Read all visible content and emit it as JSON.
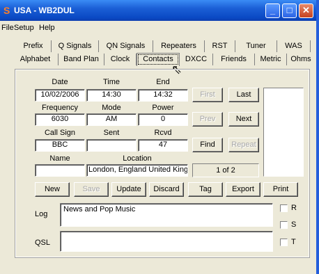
{
  "window": {
    "title": "USA - WB2DUL",
    "icon": "app-s-icon",
    "controls": {
      "minimize": "_",
      "maximize": "□",
      "close": "✕"
    }
  },
  "menu": [
    "File",
    "Setup",
    "Help"
  ],
  "tabs_row1": [
    "Prefix",
    "Q Signals",
    "QN Signals",
    "Repeaters",
    "RST",
    "Tuner",
    "WAS"
  ],
  "tabs_row2": [
    "Alphabet",
    "Band Plan",
    "Clock",
    "Contacts",
    "DXCC",
    "Friends",
    "Metric",
    "Ohms"
  ],
  "active_tab": "Contacts",
  "contact": {
    "date_label": "Date",
    "date": "10/02/2006",
    "time_label": "Time",
    "time": "14:30",
    "end_label": "End",
    "end": "14:32",
    "frequency_label": "Frequency",
    "frequency": "6030",
    "mode_label": "Mode",
    "mode": "AM",
    "power_label": "Power",
    "power": "0",
    "callsign_label": "Call Sign",
    "callsign": "BBC",
    "sent_label": "Sent",
    "sent": "",
    "rcvd_label": "Rcvd",
    "rcvd": "47",
    "name_label": "Name",
    "name": "",
    "location_label": "Location",
    "location": "London, England United Kingdom"
  },
  "nav": {
    "first": "First",
    "last": "Last",
    "prev": "Prev",
    "next": "Next",
    "find": "Find",
    "repeat": "Repeat",
    "record": "1 of 2"
  },
  "actions": [
    "New",
    "Save",
    "Update",
    "Discard",
    "Tag",
    "Export",
    "Print"
  ],
  "log": {
    "label": "Log",
    "value": "News and Pop Music"
  },
  "qsl": {
    "label": "QSL",
    "value": ""
  },
  "checkboxes": [
    "R",
    "S",
    "T"
  ]
}
